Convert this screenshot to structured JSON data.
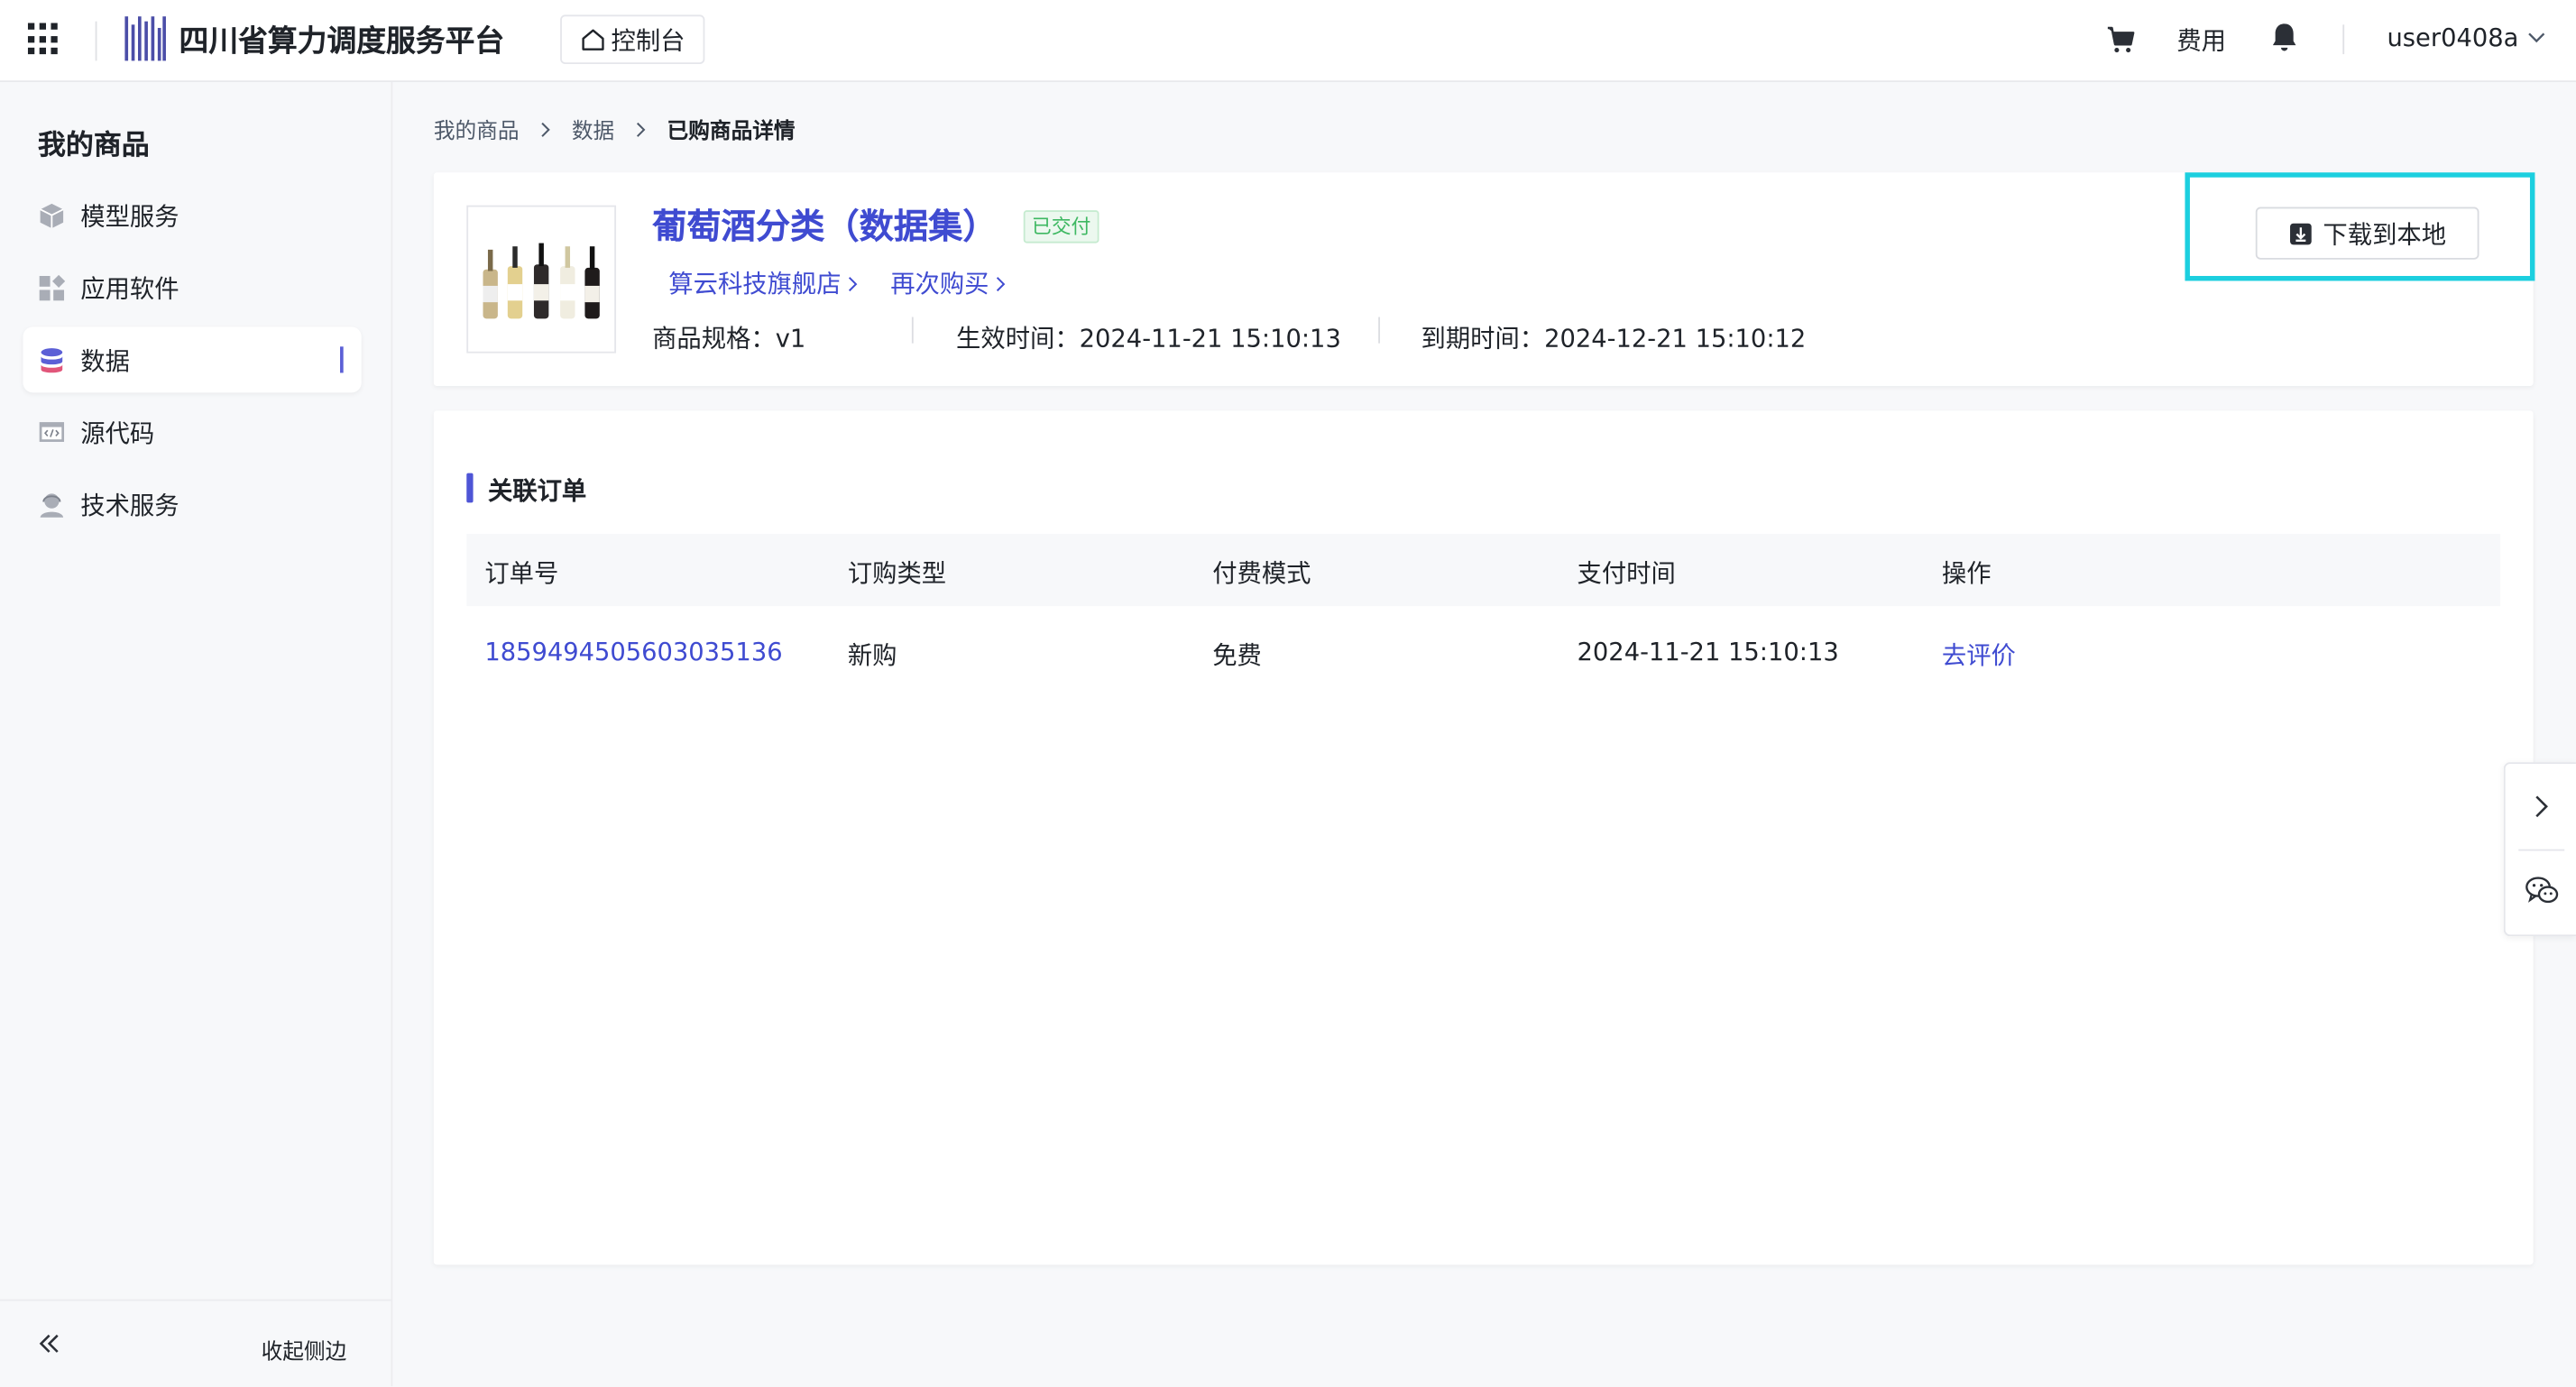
{
  "header": {
    "platform_title": "四川省算力调度服务平台",
    "console_label": "控制台",
    "fee_label": "费用",
    "username": "user0408a",
    "icons": [
      "apps-grid-icon",
      "logo-icon",
      "home-icon",
      "cart-icon",
      "bell-icon",
      "chevron-down-icon"
    ]
  },
  "sidebar": {
    "title": "我的商品",
    "items": [
      {
        "label": "模型服务",
        "icon": "cube-icon",
        "active": false
      },
      {
        "label": "应用软件",
        "icon": "apps-icon",
        "active": false
      },
      {
        "label": "数据",
        "icon": "database-icon",
        "active": true
      },
      {
        "label": "源代码",
        "icon": "code-icon",
        "active": false
      },
      {
        "label": "技术服务",
        "icon": "person-icon",
        "active": false
      }
    ],
    "collapse_label": "收起侧边"
  },
  "breadcrumb": [
    "我的商品",
    "数据",
    "已购商品详情"
  ],
  "product": {
    "name": "葡萄酒分类（数据集）",
    "status": "已交付",
    "store_link": "算云科技旗舰店",
    "rebuy_link": "再次购买",
    "spec": "商品规格：v1",
    "effective_time": "生效时间：2024-11-21 15:10:13",
    "expire_time": "到期时间：2024-12-21 15:10:12",
    "download_label": "下载到本地"
  },
  "orders": {
    "section_title": "关联订单",
    "columns": [
      "订单号",
      "订购类型",
      "付费模式",
      "支付时间",
      "操作"
    ],
    "rows": [
      {
        "order_no": "1859494505603035136",
        "type": "新购",
        "pay_mode": "免费",
        "pay_time": "2024-11-21 15:10:13",
        "action": "去评价"
      }
    ]
  },
  "colors": {
    "brand": "#3f4bd1",
    "highlight": "#1ccfdf",
    "status_green": "#3eb862"
  }
}
